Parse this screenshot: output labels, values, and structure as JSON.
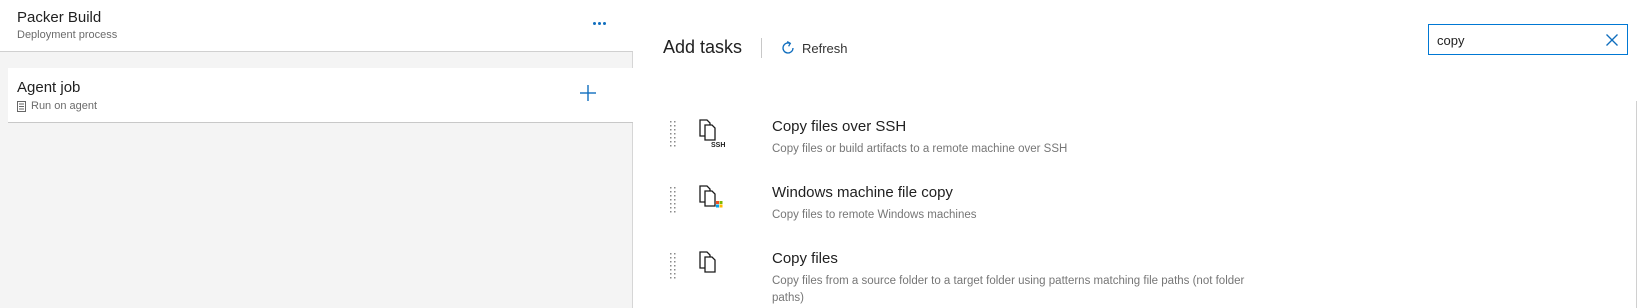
{
  "process": {
    "title": "Packer Build",
    "subtitle": "Deployment process"
  },
  "job": {
    "title": "Agent job",
    "subtitle": "Run on agent"
  },
  "add_tasks": {
    "title": "Add tasks",
    "refresh_label": "Refresh",
    "search_value": "copy"
  },
  "tasks": [
    {
      "name": "Copy files over SSH",
      "description": "Copy files or build artifacts to a remote machine over SSH",
      "icon": "copy-ssh-icon"
    },
    {
      "name": "Windows machine file copy",
      "description": "Copy files to remote Windows machines",
      "icon": "windows-file-copy-icon"
    },
    {
      "name": "Copy files",
      "description": "Copy files from a source folder to a target folder using patterns matching file paths (not folder paths)",
      "icon": "copy-files-icon"
    }
  ],
  "colors": {
    "accent": "#0078d4",
    "pane_background": "#f4f4f4"
  }
}
